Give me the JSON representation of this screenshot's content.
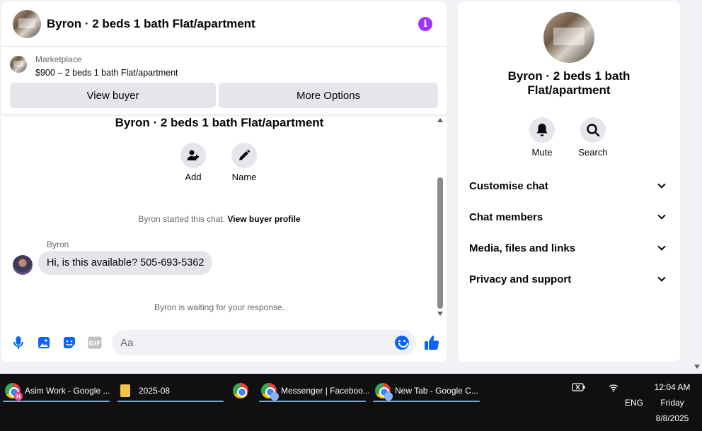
{
  "chat": {
    "header_title": "Byron · 2 beds 1 bath Flat/apartment",
    "listing": {
      "source": "Marketplace",
      "price_line": "$900 – 2 beds 1 bath Flat/apartment"
    },
    "buttons": {
      "view_buyer": "View buyer",
      "more_options": "More Options"
    },
    "conversation_title": "Byron · 2 beds 1 bath Flat/apartment",
    "quick_actions": {
      "add": "Add",
      "name": "Name"
    },
    "system_message": {
      "prefix": "Byron started this chat.",
      "link": "View buyer profile"
    },
    "message": {
      "sender": "Byron",
      "text": "Hi, is this available? 505-693-5362"
    },
    "waiting_text": "Byron is waiting for your response.",
    "composer": {
      "placeholder": "Aa"
    }
  },
  "side": {
    "title": "Byron · 2 beds 1 bath Flat/apartment",
    "actions": {
      "mute": "Mute",
      "search": "Search"
    },
    "sections": [
      "Customise chat",
      "Chat members",
      "Media, files and links",
      "Privacy and support"
    ]
  },
  "taskbar": {
    "items": [
      {
        "label": "Asim Work - Google ...",
        "badge": "H"
      },
      {
        "label": "2025-08"
      },
      {
        "label": "Messenger | Faceboo..."
      },
      {
        "label": "New Tab - Google C..."
      }
    ],
    "language": "ENG",
    "time": "12:04 AM",
    "day": "Friday",
    "date": "8/8/2025"
  },
  "colors": {
    "accent": "#0866ff",
    "info": "#a033ff",
    "bubble": "#e4e6eb",
    "taskbar": "#101010"
  }
}
